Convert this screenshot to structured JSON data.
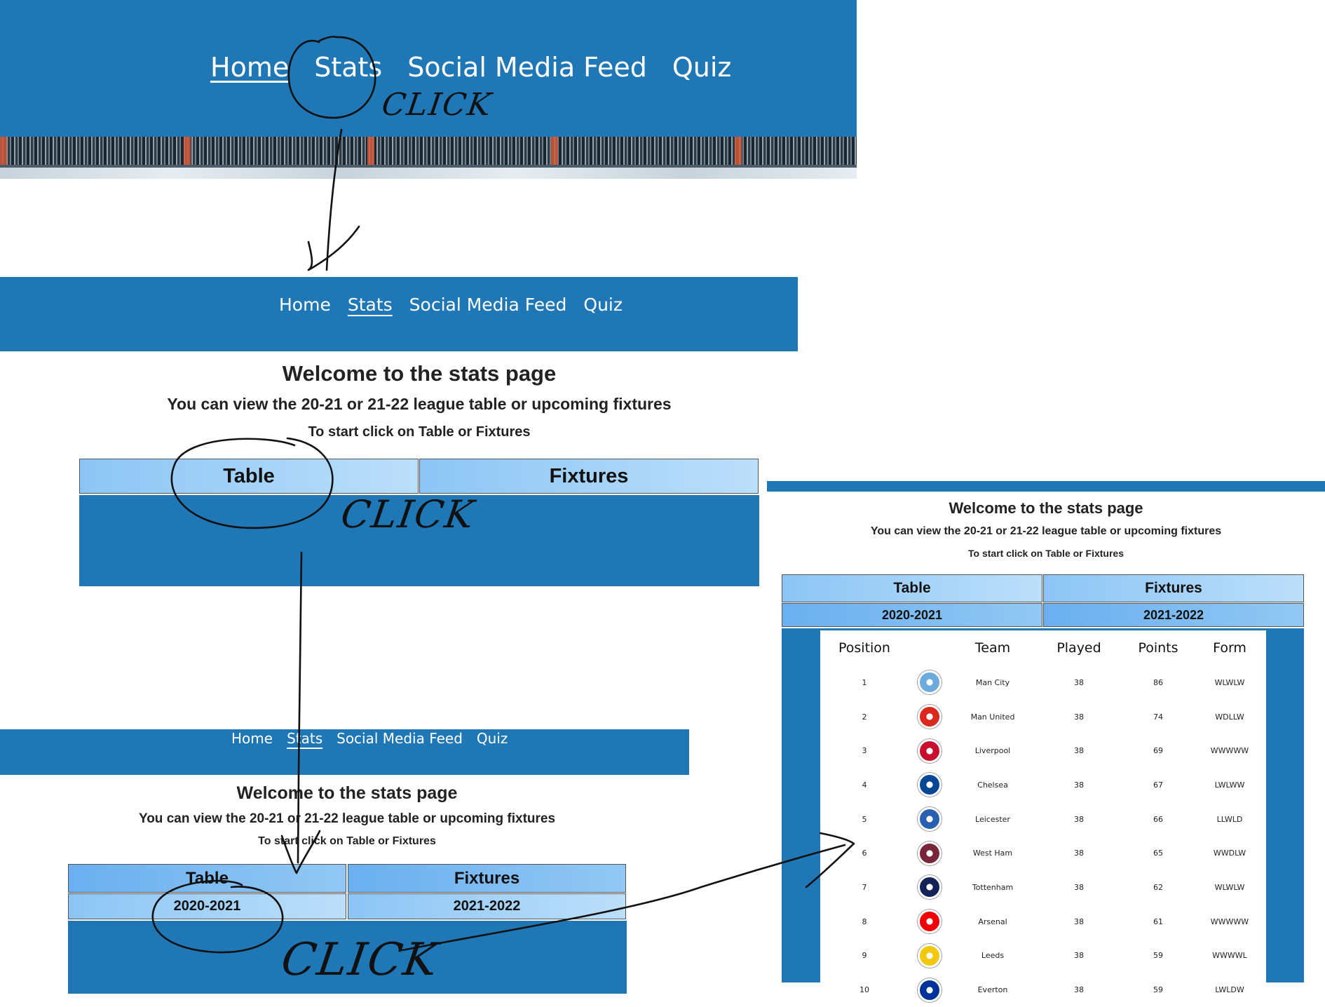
{
  "nav": [
    "Home",
    "Stats",
    "Social Media Feed",
    "Quiz"
  ],
  "stats_page": {
    "heading": "Welcome to the stats page",
    "subheading": "You can view the 20-21 or 21-22 league table or upcoming fixtures",
    "instruction": "To start click on Table or Fixtures",
    "table_btn": "Table",
    "fixtures_btn": "Fixtures",
    "season_2021": "2020-2021",
    "season_2122": "2021-2022"
  },
  "annotation": {
    "click": "CLICK"
  },
  "league_table": {
    "headers": [
      "Position",
      "Team",
      "Played",
      "Points",
      "Form"
    ],
    "rows": [
      {
        "pos": "1",
        "team": "Man City",
        "played": "38",
        "points": "86",
        "form": "WLWLW",
        "crest": "man-city-crest-icon",
        "color": "#6cabdd"
      },
      {
        "pos": "2",
        "team": "Man United",
        "played": "38",
        "points": "74",
        "form": "WDLLW",
        "crest": "man-united-crest-icon",
        "color": "#da291c"
      },
      {
        "pos": "3",
        "team": "Liverpool",
        "played": "38",
        "points": "69",
        "form": "WWWWW",
        "crest": "liverpool-crest-icon",
        "color": "#c8102e"
      },
      {
        "pos": "4",
        "team": "Chelsea",
        "played": "38",
        "points": "67",
        "form": "LWLWW",
        "crest": "chelsea-crest-icon",
        "color": "#034694"
      },
      {
        "pos": "5",
        "team": "Leicester",
        "played": "38",
        "points": "66",
        "form": "LLWLD",
        "crest": "leicester-crest-icon",
        "color": "#2a5fb0"
      },
      {
        "pos": "6",
        "team": "West Ham",
        "played": "38",
        "points": "65",
        "form": "WWDLW",
        "crest": "west-ham-crest-icon",
        "color": "#7a263a"
      },
      {
        "pos": "7",
        "team": "Tottenham",
        "played": "38",
        "points": "62",
        "form": "WLWLW",
        "crest": "tottenham-crest-icon",
        "color": "#132257"
      },
      {
        "pos": "8",
        "team": "Arsenal",
        "played": "38",
        "points": "61",
        "form": "WWWWW",
        "crest": "arsenal-crest-icon",
        "color": "#ef0107"
      },
      {
        "pos": "9",
        "team": "Leeds",
        "played": "38",
        "points": "59",
        "form": "WWWWL",
        "crest": "leeds-crest-icon",
        "color": "#f2c80f"
      },
      {
        "pos": "10",
        "team": "Everton",
        "played": "38",
        "points": "59",
        "form": "LWLDW",
        "crest": "everton-crest-icon",
        "color": "#003399"
      }
    ]
  },
  "colors": {
    "nav_blue": "#2077b5",
    "button_light": "#9fcff7",
    "button_mid": "#7ab8f2"
  }
}
